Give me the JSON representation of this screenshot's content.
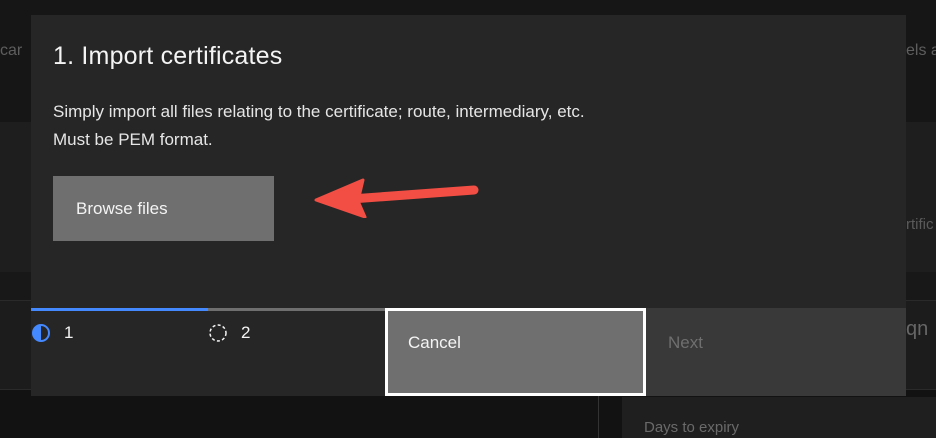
{
  "background": {
    "text_left_top": "car",
    "text_right_top": "els a",
    "text_right_mid": "rtific",
    "text_right_row": "qn",
    "days_to_expiry_label": "Days to expiry"
  },
  "modal": {
    "title": "1. Import certificates",
    "description_line1": "Simply import all files relating to the certificate; route, intermediary, etc.",
    "description_line2": "Must be PEM format.",
    "browse_button_label": "Browse files"
  },
  "progress": {
    "steps": [
      {
        "label": "1",
        "state": "current"
      },
      {
        "label": "2",
        "state": "incomplete"
      }
    ],
    "completed_fraction": 0.5
  },
  "footer": {
    "cancel_label": "Cancel",
    "next_label": "Next",
    "next_disabled": true
  },
  "colors": {
    "accent": "#4589ff",
    "annotation_arrow": "#f24e44"
  },
  "icons": {
    "step_current": "half-filled-circle-icon",
    "step_incomplete": "dashed-circle-icon",
    "annotation": "red-arrow-left-icon"
  }
}
